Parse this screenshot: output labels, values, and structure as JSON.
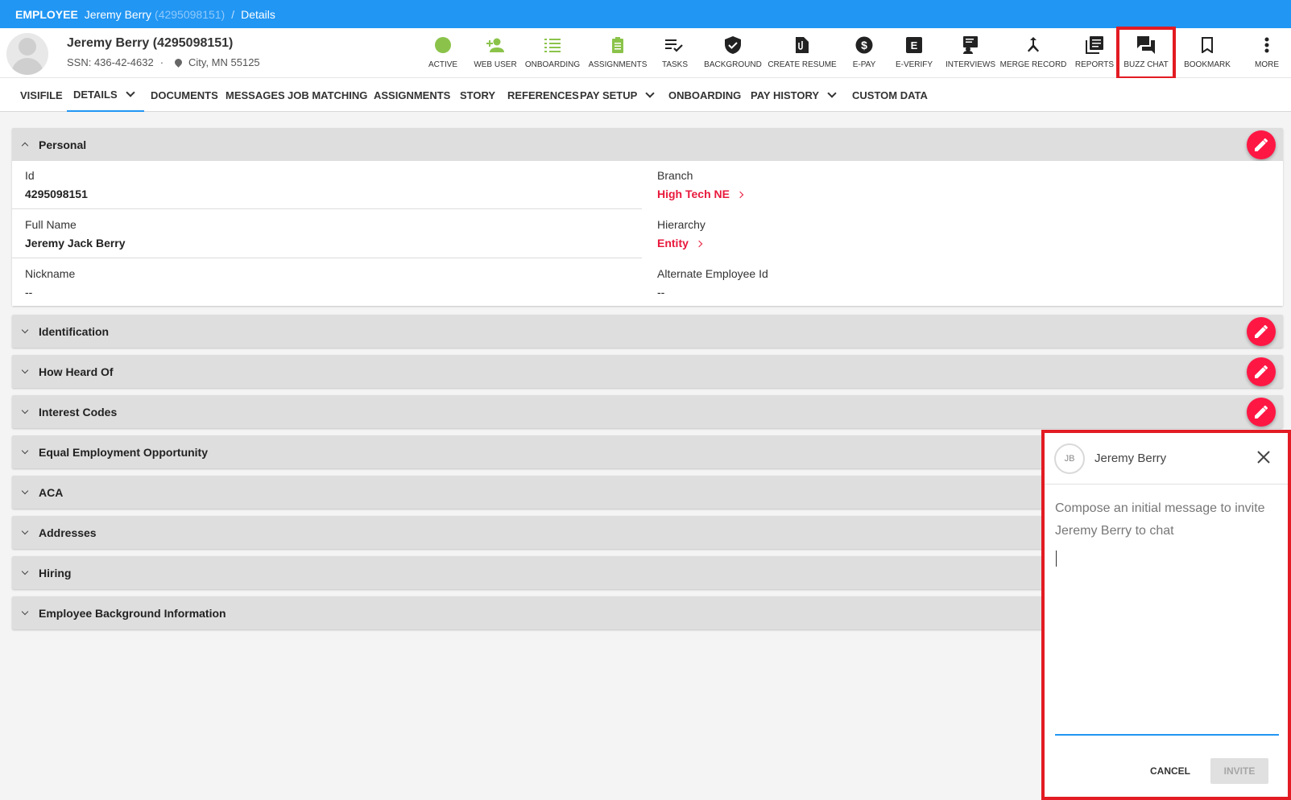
{
  "breadcrumb": {
    "type": "EMPLOYEE",
    "name": "Jeremy Berry",
    "id": "(4295098151)",
    "separator": "/",
    "page": "Details"
  },
  "header": {
    "name": "Jeremy Berry (4295098151)",
    "ssn": "SSN: 436-42-4632",
    "dot": "·",
    "location": "City, MN 55125"
  },
  "actions": [
    {
      "label": "ACTIVE",
      "icon": "status-dot-icon"
    },
    {
      "label": "WEB USER",
      "icon": "person-add-icon"
    },
    {
      "label": "ONBOARDING",
      "icon": "checklist-icon"
    },
    {
      "label": "ASSIGNMENTS",
      "icon": "clipboard-icon"
    },
    {
      "label": "TASKS",
      "icon": "playlist-check-icon"
    },
    {
      "label": "BACKGROUND",
      "icon": "shield-check-icon"
    },
    {
      "label": "CREATE RESUME",
      "icon": "document-clip-icon"
    },
    {
      "label": "E-PAY",
      "icon": "dollar-icon"
    },
    {
      "label": "E-VERIFY",
      "icon": "e-badge-icon"
    },
    {
      "label": "INTERVIEWS",
      "icon": "interview-icon"
    },
    {
      "label": "MERGE RECORD",
      "icon": "merge-icon"
    },
    {
      "label": "REPORTS",
      "icon": "reports-icon"
    },
    {
      "label": "BUZZ CHAT",
      "icon": "chat-icon"
    },
    {
      "label": "BOOKMARK",
      "icon": "bookmark-icon"
    },
    {
      "label": "MORE",
      "icon": "more-vertical-icon"
    }
  ],
  "tabs": [
    "VISIFILE",
    "DETAILS",
    "DOCUMENTS",
    "MESSAGES",
    "JOB MATCHING",
    "ASSIGNMENTS",
    "STORY",
    "REFERENCES",
    "PAY SETUP",
    "ONBOARDING",
    "PAY HISTORY",
    "CUSTOM DATA"
  ],
  "personal": {
    "title": "Personal",
    "id_label": "Id",
    "id_value": "4295098151",
    "branch_label": "Branch",
    "branch_value": "High Tech NE",
    "fullname_label": "Full Name",
    "fullname_value": "Jeremy Jack Berry",
    "hierarchy_label": "Hierarchy",
    "hierarchy_value": "Entity",
    "nickname_label": "Nickname",
    "nickname_value": "--",
    "altid_label": "Alternate Employee Id",
    "altid_value": "--"
  },
  "sections": [
    "Identification",
    "How Heard Of",
    "Interest Codes",
    "Equal Employment Opportunity",
    "ACA",
    "Addresses",
    "Hiring",
    "Employee Background Information"
  ],
  "chat": {
    "initials": "JB",
    "name": "Jeremy Berry",
    "prompt": "Compose an initial message to invite Jeremy Berry to chat",
    "message": "",
    "cancel": "CANCEL",
    "invite": "INVITE"
  },
  "colors": {
    "primary": "#2196f3",
    "accent": "#ff1744",
    "link": "#e8193c",
    "active": "#8bc34a",
    "highlight": "#e31b23"
  }
}
